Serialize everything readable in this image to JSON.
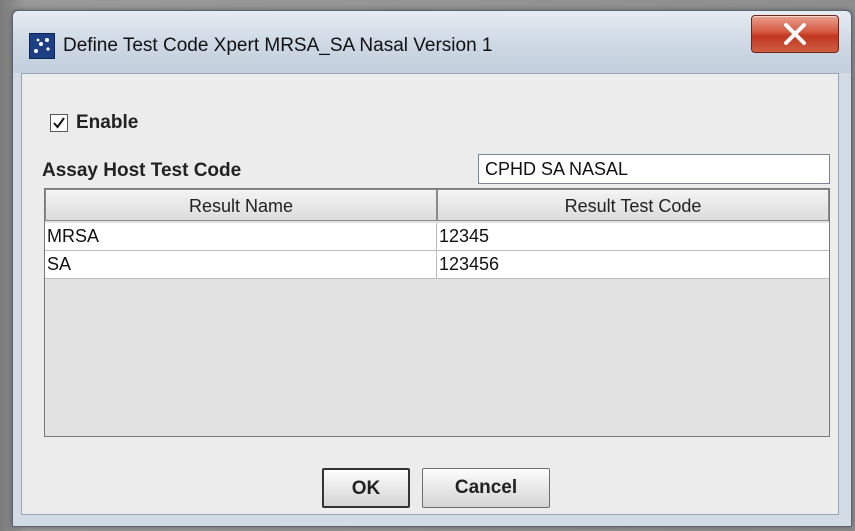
{
  "window": {
    "title": "Define Test Code Xpert MRSA_SA Nasal Version 1",
    "close_glyph": "X"
  },
  "form": {
    "enable_label": "Enable",
    "enable_checked": true,
    "host_label": "Assay Host Test Code",
    "host_value": "CPHD SA NASAL"
  },
  "table": {
    "columns": [
      "Result Name",
      "Result Test Code"
    ],
    "rows": [
      {
        "name": "MRSA",
        "code": "12345"
      },
      {
        "name": "SA",
        "code": "123456"
      }
    ]
  },
  "buttons": {
    "ok_label": "OK",
    "cancel_label": "Cancel"
  },
  "icons": {
    "app": "app-window-icon",
    "close": "close-icon",
    "check": "checkmark-icon"
  },
  "colors": {
    "close_button": "#d6573f",
    "titlebar": "#cdd8e4",
    "panel": "#ececec"
  }
}
